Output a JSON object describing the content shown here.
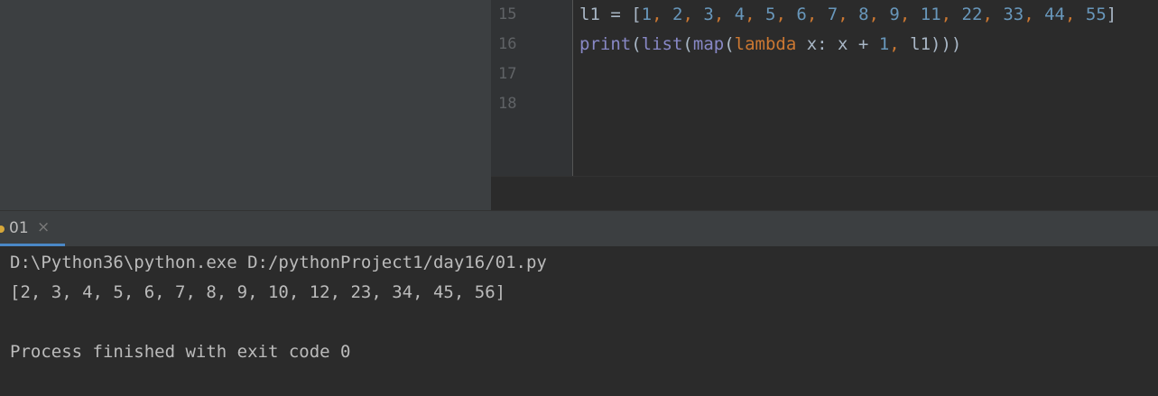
{
  "editor": {
    "line_numbers": [
      "15",
      "16",
      "17",
      "18"
    ],
    "line15": {
      "var": "l1",
      "assign": " = ",
      "open": "[",
      "items": [
        "1",
        "2",
        "3",
        "4",
        "5",
        "6",
        "7",
        "8",
        "9",
        "11",
        "22",
        "33",
        "44",
        "55"
      ],
      "sep": ", ",
      "close": "]"
    },
    "line16": {
      "print": "print",
      "p1": "(",
      "list": "list",
      "p2": "(",
      "map": "map",
      "p3": "(",
      "lambda": "lambda",
      "body_a": " x: x + ",
      "one": "1",
      "comma": ", ",
      "arg": "l1",
      "close": ")))"
    }
  },
  "run_panel": {
    "tab_label": "01",
    "close_glyph": "×",
    "console_lines": [
      "D:\\Python36\\python.exe D:/pythonProject1/day16/01.py",
      "[2, 3, 4, 5, 6, 7, 8, 9, 10, 12, 23, 34, 45, 56]",
      "",
      "Process finished with exit code 0"
    ]
  },
  "colors": {
    "number": "#6897bb",
    "keyword": "#cc7832",
    "builtin": "#8888c6",
    "text": "#a9b7c6"
  }
}
